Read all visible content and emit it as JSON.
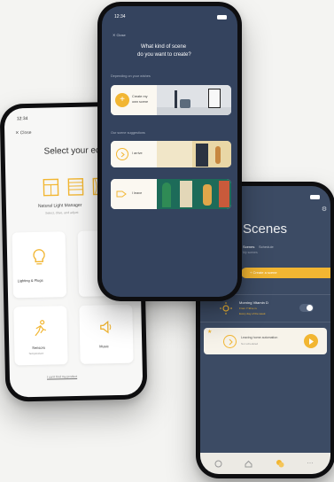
{
  "left_phone": {
    "status_time": "12:34",
    "back_label": "Close",
    "title": "Select your equip",
    "featured_label": "Natural Light Manager",
    "featured_sub": "Select, drive, and adjust",
    "tiles": [
      {
        "label": "Lighting & Plugs",
        "icon": "bulb-icon"
      },
      {
        "label": "Sensors",
        "icon": "run-icon",
        "sub": "Temperature"
      },
      {
        "label": "Music",
        "icon": "speaker-icon"
      }
    ],
    "footer_link": "I can't find my product"
  },
  "center_phone": {
    "status_time": "12:34",
    "back_label": "Close",
    "title_line1": "What kind of scene",
    "title_line2": "do you want to create?",
    "section_personal": "Depending on your wishes",
    "create_label_line1": "Create my",
    "create_label_line2": "own scene",
    "section_suggestions": "Our scene suggestions",
    "suggestions": [
      {
        "label": "I arrive",
        "icon": "arrive-icon"
      },
      {
        "label": "I leave",
        "icon": "leave-icon"
      }
    ]
  },
  "right_phone": {
    "title": "Scenes",
    "tabs": [
      "Scenes",
      "Schedule"
    ],
    "subtitle": "My scenes",
    "create_button": "+ Create a scene",
    "scene_rows": [
      {
        "title": "Morning Vitamin D",
        "sub": "From 7:30 a.m.",
        "sub2": "Every day of the week",
        "toggle": true
      },
      {
        "title": "Leaving home automation",
        "sub": "Not scheduled"
      }
    ],
    "nav": [
      "home-icon",
      "house-icon",
      "scenes-icon",
      "more-icon"
    ]
  },
  "colors": {
    "accent": "#f2b632",
    "navy": "#34435e",
    "slate": "#3c4b64"
  }
}
